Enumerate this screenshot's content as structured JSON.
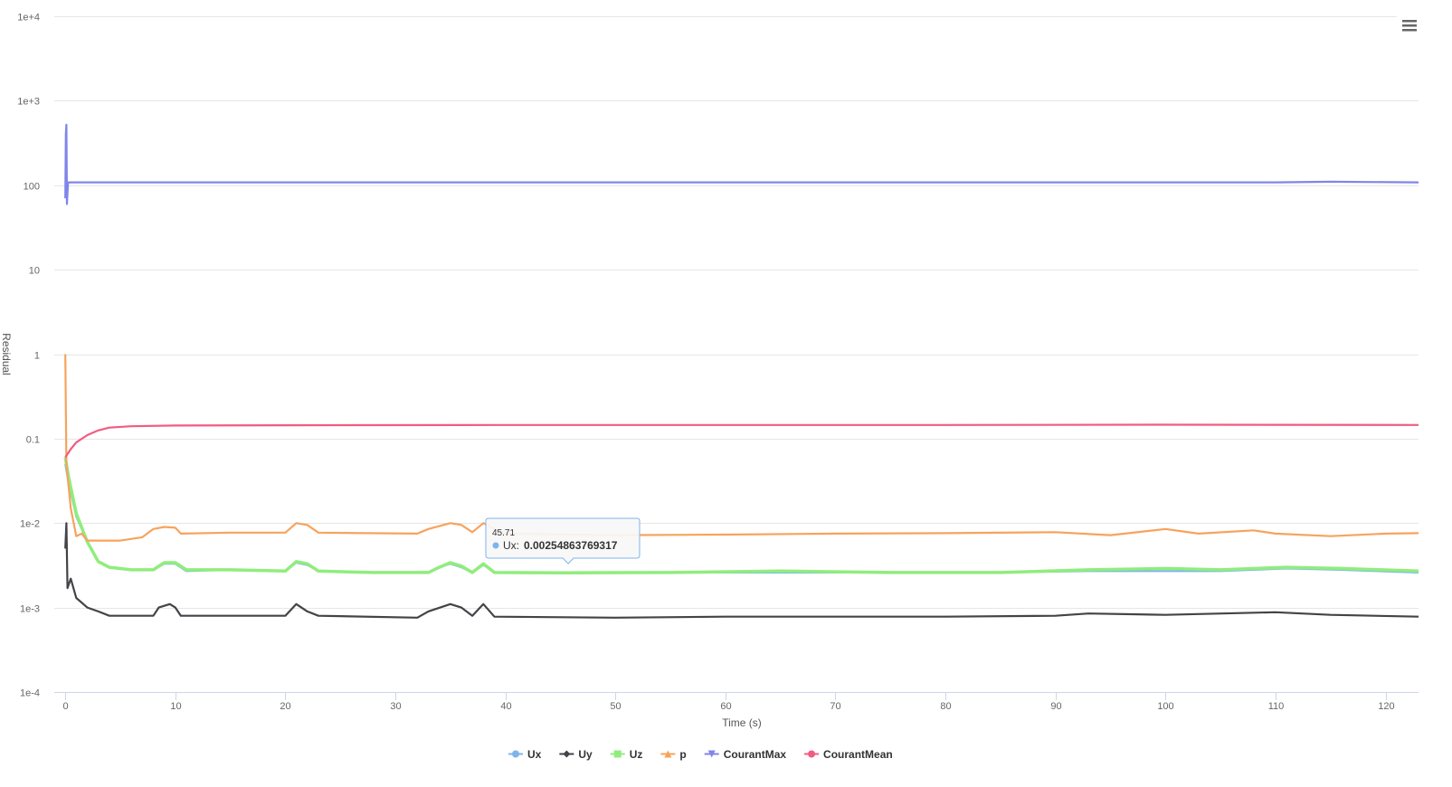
{
  "chart_data": {
    "type": "line",
    "title": "",
    "xlabel": "Time (s)",
    "ylabel": "Residual",
    "xlim": [
      -1,
      123
    ],
    "ylim": [
      0.0001,
      10000
    ],
    "yscale": "log",
    "grid": true,
    "legend_position": "bottom-center",
    "x_ticks": [
      0,
      10,
      20,
      30,
      40,
      50,
      60,
      70,
      80,
      90,
      100,
      110,
      120
    ],
    "x_tick_labels": [
      "0",
      "10",
      "20",
      "30",
      "40",
      "50",
      "60",
      "70",
      "80",
      "90",
      "100",
      "110",
      "120"
    ],
    "y_ticks": [
      0.0001,
      0.001,
      0.01,
      0.1,
      1,
      10,
      100,
      1000,
      10000
    ],
    "y_tick_labels": [
      "1e-4",
      "1e-3",
      "1e-2",
      "0.1",
      "1",
      "10",
      "100",
      "1e+3",
      "1e+4"
    ],
    "series": [
      {
        "name": "Ux",
        "color": "#7cb5ec",
        "marker": "circle",
        "points": [
          [
            0,
            0.05
          ],
          [
            0.3,
            0.03
          ],
          [
            1,
            0.012
          ],
          [
            2,
            0.006
          ],
          [
            3,
            0.0035
          ],
          [
            4,
            0.003
          ],
          [
            6,
            0.0028
          ],
          [
            8,
            0.0028
          ],
          [
            9,
            0.0033
          ],
          [
            10,
            0.0033
          ],
          [
            11,
            0.0027
          ],
          [
            15,
            0.0028
          ],
          [
            20,
            0.0027
          ],
          [
            21,
            0.0034
          ],
          [
            22,
            0.0032
          ],
          [
            23,
            0.0027
          ],
          [
            28,
            0.0026
          ],
          [
            33,
            0.0026
          ],
          [
            34,
            0.003
          ],
          [
            35,
            0.0033
          ],
          [
            36,
            0.003
          ],
          [
            37,
            0.0026
          ],
          [
            38,
            0.0032
          ],
          [
            39,
            0.0026
          ],
          [
            45.71,
            0.00254863769317
          ],
          [
            55,
            0.0026
          ],
          [
            65,
            0.0026
          ],
          [
            75,
            0.0026
          ],
          [
            85,
            0.0026
          ],
          [
            93,
            0.0027
          ],
          [
            100,
            0.0027
          ],
          [
            105,
            0.0027
          ],
          [
            111,
            0.0029
          ],
          [
            116,
            0.0028
          ],
          [
            123,
            0.0026
          ]
        ]
      },
      {
        "name": "Uy",
        "color": "#434348",
        "marker": "diamond",
        "points": [
          [
            0,
            0.005
          ],
          [
            0.1,
            0.01
          ],
          [
            0.2,
            0.0017
          ],
          [
            0.5,
            0.0022
          ],
          [
            1,
            0.0013
          ],
          [
            2,
            0.001
          ],
          [
            3,
            0.0009
          ],
          [
            4,
            0.0008
          ],
          [
            8,
            0.0008
          ],
          [
            8.5,
            0.001
          ],
          [
            9.5,
            0.0011
          ],
          [
            10,
            0.001
          ],
          [
            10.5,
            0.0008
          ],
          [
            20,
            0.0008
          ],
          [
            21,
            0.0011
          ],
          [
            22,
            0.0009
          ],
          [
            23,
            0.0008
          ],
          [
            32,
            0.00076
          ],
          [
            33,
            0.0009
          ],
          [
            35,
            0.0011
          ],
          [
            36,
            0.001
          ],
          [
            37,
            0.0008
          ],
          [
            38,
            0.0011
          ],
          [
            39,
            0.00078
          ],
          [
            50,
            0.00076
          ],
          [
            60,
            0.00078
          ],
          [
            70,
            0.00078
          ],
          [
            80,
            0.00078
          ],
          [
            90,
            0.0008
          ],
          [
            93,
            0.00085
          ],
          [
            100,
            0.00082
          ],
          [
            110,
            0.00088
          ],
          [
            115,
            0.00082
          ],
          [
            123,
            0.00078
          ]
        ]
      },
      {
        "name": "Uz",
        "color": "#90ed7d",
        "marker": "square",
        "points": [
          [
            0,
            0.06
          ],
          [
            0.3,
            0.035
          ],
          [
            1,
            0.013
          ],
          [
            2,
            0.006
          ],
          [
            3,
            0.0035
          ],
          [
            4,
            0.003
          ],
          [
            6,
            0.0028
          ],
          [
            8,
            0.0028
          ],
          [
            9,
            0.0034
          ],
          [
            10,
            0.0034
          ],
          [
            11,
            0.0028
          ],
          [
            15,
            0.0028
          ],
          [
            20,
            0.0027
          ],
          [
            21,
            0.0035
          ],
          [
            22,
            0.0033
          ],
          [
            23,
            0.0027
          ],
          [
            28,
            0.0026
          ],
          [
            33,
            0.0026
          ],
          [
            34,
            0.003
          ],
          [
            35,
            0.0034
          ],
          [
            36,
            0.0031
          ],
          [
            37,
            0.0026
          ],
          [
            38,
            0.0033
          ],
          [
            39,
            0.0026
          ],
          [
            45.71,
            0.00258
          ],
          [
            55,
            0.0026
          ],
          [
            65,
            0.0027
          ],
          [
            75,
            0.0026
          ],
          [
            85,
            0.0026
          ],
          [
            93,
            0.0028
          ],
          [
            100,
            0.0029
          ],
          [
            105,
            0.0028
          ],
          [
            111,
            0.003
          ],
          [
            116,
            0.0029
          ],
          [
            123,
            0.0027
          ]
        ]
      },
      {
        "name": "p",
        "color": "#f7a35c",
        "marker": "triangle",
        "points": [
          [
            0,
            1
          ],
          [
            0.1,
            0.05
          ],
          [
            0.5,
            0.015
          ],
          [
            1,
            0.007
          ],
          [
            1.5,
            0.0075
          ],
          [
            2,
            0.0062
          ],
          [
            5,
            0.0062
          ],
          [
            7,
            0.0068
          ],
          [
            8,
            0.0085
          ],
          [
            9,
            0.009
          ],
          [
            10,
            0.0088
          ],
          [
            10.5,
            0.0075
          ],
          [
            15,
            0.0077
          ],
          [
            20,
            0.0077
          ],
          [
            21,
            0.01
          ],
          [
            22,
            0.0095
          ],
          [
            23,
            0.0077
          ],
          [
            32,
            0.0075
          ],
          [
            33,
            0.0085
          ],
          [
            35,
            0.01
          ],
          [
            36,
            0.0095
          ],
          [
            37,
            0.0078
          ],
          [
            38,
            0.01
          ],
          [
            39,
            0.0085
          ],
          [
            40,
            0.0075
          ],
          [
            50,
            0.0072
          ],
          [
            60,
            0.0073
          ],
          [
            70,
            0.0075
          ],
          [
            80,
            0.0076
          ],
          [
            90,
            0.0078
          ],
          [
            95,
            0.0072
          ],
          [
            100,
            0.0085
          ],
          [
            103,
            0.0075
          ],
          [
            108,
            0.0082
          ],
          [
            110,
            0.0075
          ],
          [
            115,
            0.007
          ],
          [
            120,
            0.0075
          ],
          [
            123,
            0.0076
          ]
        ]
      },
      {
        "name": "CourantMax",
        "color": "#8085e9",
        "marker": "triangle-down",
        "points": [
          [
            0,
            70
          ],
          [
            0.05,
            400
          ],
          [
            0.1,
            520
          ],
          [
            0.15,
            60
          ],
          [
            0.25,
            108
          ],
          [
            10,
            108
          ],
          [
            30,
            108
          ],
          [
            50,
            108
          ],
          [
            70,
            108
          ],
          [
            90,
            108
          ],
          [
            110,
            108
          ],
          [
            115,
            110
          ],
          [
            123,
            108
          ]
        ]
      },
      {
        "name": "CourantMean",
        "color": "#f15c80",
        "marker": "circle",
        "points": [
          [
            0,
            0.06
          ],
          [
            0.5,
            0.075
          ],
          [
            1,
            0.09
          ],
          [
            2,
            0.11
          ],
          [
            3,
            0.125
          ],
          [
            4,
            0.135
          ],
          [
            6,
            0.14
          ],
          [
            10,
            0.143
          ],
          [
            20,
            0.144
          ],
          [
            40,
            0.145
          ],
          [
            60,
            0.145
          ],
          [
            80,
            0.145
          ],
          [
            100,
            0.146
          ],
          [
            123,
            0.145
          ]
        ]
      }
    ],
    "tooltip": {
      "x_label": "45.71",
      "series_name": "Ux",
      "series_label": "Ux:",
      "value": "0.00254863769317",
      "x": 45.71,
      "y": 0.00254863769317,
      "color": "#7cb5ec"
    }
  },
  "toolbar": {
    "menu_icon": "hamburger-menu-icon"
  }
}
